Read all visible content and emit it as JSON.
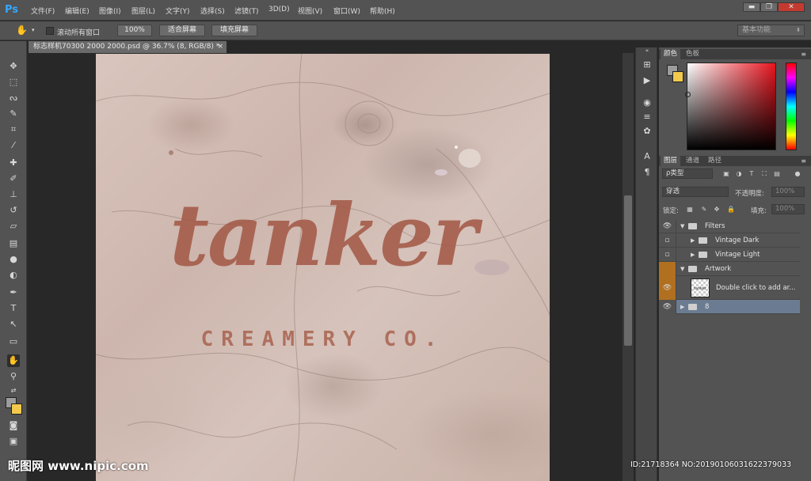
{
  "app": {
    "logo": "Ps"
  },
  "menu": [
    "文件(F)",
    "编辑(E)",
    "图像(I)",
    "图层(L)",
    "文字(Y)",
    "选择(S)",
    "滤镜(T)",
    "3D(D)",
    "视图(V)",
    "窗口(W)",
    "帮助(H)"
  ],
  "window_controls": {
    "minimize": "▬",
    "restore": "❐",
    "close": "✕"
  },
  "options": {
    "scroll_all_label": "滚动所有窗口",
    "zoom_100": "100%",
    "fit_screen": "适合屏幕",
    "fill_screen": "填充屏幕",
    "workspace": "基本功能"
  },
  "document": {
    "tab_title": "标志样机70300 2000 2000.psd @ 36.7% (8, RGB/8) *",
    "tab_close": "×",
    "brand_name": "tanker",
    "tagline": "CREAMERY CO."
  },
  "color_panel": {
    "tabs": [
      "颜色",
      "色板"
    ],
    "foreground": "#9c9c9c",
    "background": "#f2c94c"
  },
  "layers_panel": {
    "tabs": [
      "图层",
      "通道",
      "路径"
    ],
    "filter_kind": "ρ类型",
    "blend_mode": "穿透",
    "opacity_label": "不透明度:",
    "opacity_value": "100%",
    "lock_label": "锁定:",
    "fill_label": "填充:",
    "fill_value": "100%",
    "layers": [
      {
        "name": "Filters",
        "type": "group",
        "expanded": true,
        "visible": true
      },
      {
        "name": "Vintage Dark",
        "type": "group",
        "expanded": false,
        "visible": false
      },
      {
        "name": "Vintage Light",
        "type": "group",
        "expanded": false,
        "visible": false
      },
      {
        "name": "Artwork",
        "type": "group",
        "expanded": true,
        "visible": false
      },
      {
        "name": "Double click to add ar...",
        "type": "smart-object",
        "visible": true
      },
      {
        "name": "8",
        "type": "group",
        "expanded": false,
        "visible": true,
        "selected": true
      }
    ]
  },
  "watermark": {
    "left": "昵图网 www.nipic.com",
    "right": "ID:21718364 NO:20190106031622379033"
  }
}
